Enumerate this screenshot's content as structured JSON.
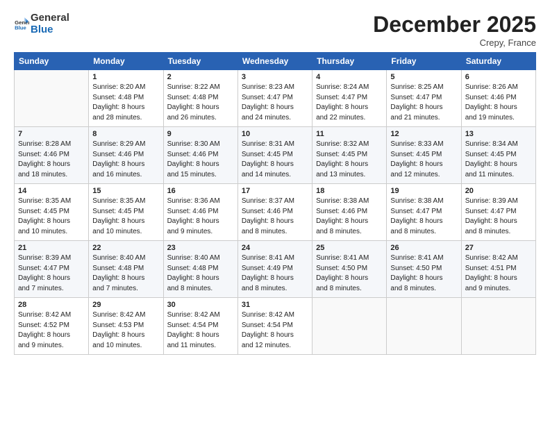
{
  "logo": {
    "line1": "General",
    "line2": "Blue"
  },
  "title": "December 2025",
  "subtitle": "Crepy, France",
  "days_header": [
    "Sunday",
    "Monday",
    "Tuesday",
    "Wednesday",
    "Thursday",
    "Friday",
    "Saturday"
  ],
  "weeks": [
    [
      {
        "day": "",
        "info": ""
      },
      {
        "day": "1",
        "info": "Sunrise: 8:20 AM\nSunset: 4:48 PM\nDaylight: 8 hours\nand 28 minutes."
      },
      {
        "day": "2",
        "info": "Sunrise: 8:22 AM\nSunset: 4:48 PM\nDaylight: 8 hours\nand 26 minutes."
      },
      {
        "day": "3",
        "info": "Sunrise: 8:23 AM\nSunset: 4:47 PM\nDaylight: 8 hours\nand 24 minutes."
      },
      {
        "day": "4",
        "info": "Sunrise: 8:24 AM\nSunset: 4:47 PM\nDaylight: 8 hours\nand 22 minutes."
      },
      {
        "day": "5",
        "info": "Sunrise: 8:25 AM\nSunset: 4:47 PM\nDaylight: 8 hours\nand 21 minutes."
      },
      {
        "day": "6",
        "info": "Sunrise: 8:26 AM\nSunset: 4:46 PM\nDaylight: 8 hours\nand 19 minutes."
      }
    ],
    [
      {
        "day": "7",
        "info": "Sunrise: 8:28 AM\nSunset: 4:46 PM\nDaylight: 8 hours\nand 18 minutes."
      },
      {
        "day": "8",
        "info": "Sunrise: 8:29 AM\nSunset: 4:46 PM\nDaylight: 8 hours\nand 16 minutes."
      },
      {
        "day": "9",
        "info": "Sunrise: 8:30 AM\nSunset: 4:46 PM\nDaylight: 8 hours\nand 15 minutes."
      },
      {
        "day": "10",
        "info": "Sunrise: 8:31 AM\nSunset: 4:45 PM\nDaylight: 8 hours\nand 14 minutes."
      },
      {
        "day": "11",
        "info": "Sunrise: 8:32 AM\nSunset: 4:45 PM\nDaylight: 8 hours\nand 13 minutes."
      },
      {
        "day": "12",
        "info": "Sunrise: 8:33 AM\nSunset: 4:45 PM\nDaylight: 8 hours\nand 12 minutes."
      },
      {
        "day": "13",
        "info": "Sunrise: 8:34 AM\nSunset: 4:45 PM\nDaylight: 8 hours\nand 11 minutes."
      }
    ],
    [
      {
        "day": "14",
        "info": "Sunrise: 8:35 AM\nSunset: 4:45 PM\nDaylight: 8 hours\nand 10 minutes."
      },
      {
        "day": "15",
        "info": "Sunrise: 8:35 AM\nSunset: 4:45 PM\nDaylight: 8 hours\nand 10 minutes."
      },
      {
        "day": "16",
        "info": "Sunrise: 8:36 AM\nSunset: 4:46 PM\nDaylight: 8 hours\nand 9 minutes."
      },
      {
        "day": "17",
        "info": "Sunrise: 8:37 AM\nSunset: 4:46 PM\nDaylight: 8 hours\nand 8 minutes."
      },
      {
        "day": "18",
        "info": "Sunrise: 8:38 AM\nSunset: 4:46 PM\nDaylight: 8 hours\nand 8 minutes."
      },
      {
        "day": "19",
        "info": "Sunrise: 8:38 AM\nSunset: 4:47 PM\nDaylight: 8 hours\nand 8 minutes."
      },
      {
        "day": "20",
        "info": "Sunrise: 8:39 AM\nSunset: 4:47 PM\nDaylight: 8 hours\nand 8 minutes."
      }
    ],
    [
      {
        "day": "21",
        "info": "Sunrise: 8:39 AM\nSunset: 4:47 PM\nDaylight: 8 hours\nand 7 minutes."
      },
      {
        "day": "22",
        "info": "Sunrise: 8:40 AM\nSunset: 4:48 PM\nDaylight: 8 hours\nand 7 minutes."
      },
      {
        "day": "23",
        "info": "Sunrise: 8:40 AM\nSunset: 4:48 PM\nDaylight: 8 hours\nand 8 minutes."
      },
      {
        "day": "24",
        "info": "Sunrise: 8:41 AM\nSunset: 4:49 PM\nDaylight: 8 hours\nand 8 minutes."
      },
      {
        "day": "25",
        "info": "Sunrise: 8:41 AM\nSunset: 4:50 PM\nDaylight: 8 hours\nand 8 minutes."
      },
      {
        "day": "26",
        "info": "Sunrise: 8:41 AM\nSunset: 4:50 PM\nDaylight: 8 hours\nand 8 minutes."
      },
      {
        "day": "27",
        "info": "Sunrise: 8:42 AM\nSunset: 4:51 PM\nDaylight: 8 hours\nand 9 minutes."
      }
    ],
    [
      {
        "day": "28",
        "info": "Sunrise: 8:42 AM\nSunset: 4:52 PM\nDaylight: 8 hours\nand 9 minutes."
      },
      {
        "day": "29",
        "info": "Sunrise: 8:42 AM\nSunset: 4:53 PM\nDaylight: 8 hours\nand 10 minutes."
      },
      {
        "day": "30",
        "info": "Sunrise: 8:42 AM\nSunset: 4:54 PM\nDaylight: 8 hours\nand 11 minutes."
      },
      {
        "day": "31",
        "info": "Sunrise: 8:42 AM\nSunset: 4:54 PM\nDaylight: 8 hours\nand 12 minutes."
      },
      {
        "day": "",
        "info": ""
      },
      {
        "day": "",
        "info": ""
      },
      {
        "day": "",
        "info": ""
      }
    ]
  ]
}
